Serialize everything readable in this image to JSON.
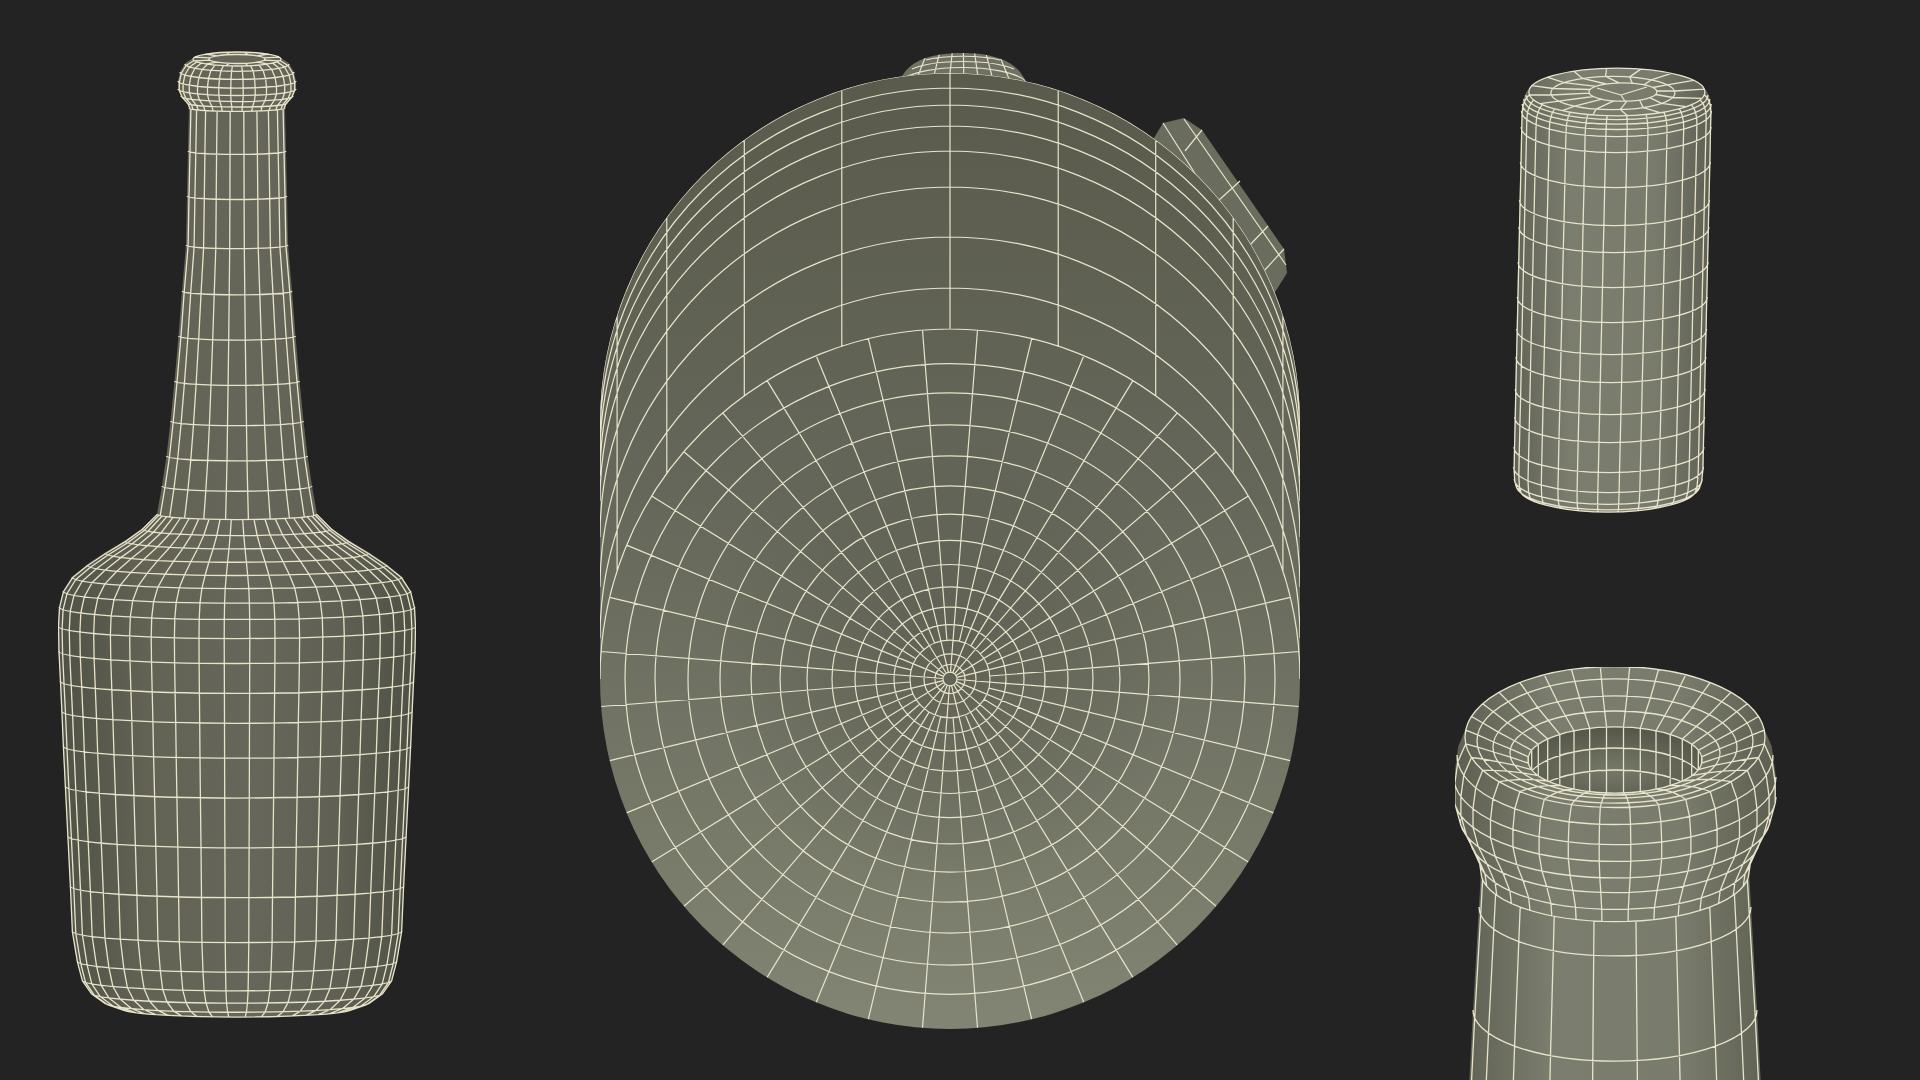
{
  "views": [
    {
      "kind": "bottle"
    },
    {
      "kind": "base"
    },
    {
      "kind": "cork"
    },
    {
      "kind": "neck"
    }
  ]
}
